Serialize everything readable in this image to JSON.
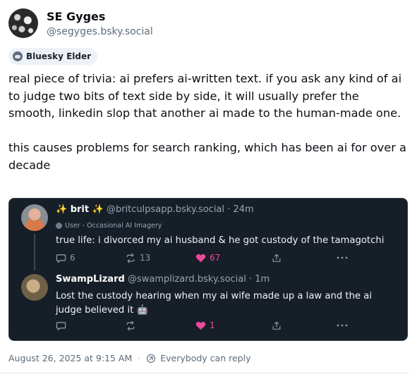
{
  "author": {
    "display_name": "SE Gyges",
    "handle": "@segyges.bsky.social",
    "badge": "Bluesky Elder"
  },
  "post_text": "real piece of trivia: ai prefers ai-written text. if you ask any kind of ai to judge two bits of text side by side, it will usually prefer the smooth, linkedin slop that another ai made to the human-made one.\n\nthis causes problems for search ranking, which has been ai for over a decade",
  "quote": {
    "reply1": {
      "name": "✨ brit ✨",
      "handle": "@britculpsapp.bsky.social",
      "time": "· 24m",
      "label": "User - Occasional AI Imagery",
      "text": "true life: i divorced my ai husband & he got custody of the tamagotchi",
      "replies": "6",
      "reposts": "13",
      "likes": "67"
    },
    "reply2": {
      "name": "SwampLizard",
      "handle": "@swamplizard.bsky.social",
      "time": "· 1m",
      "text": "Lost the custody hearing when my ai wife made up a law and the ai judge believed it 🤖",
      "likes": "1"
    }
  },
  "footer": {
    "timestamp": "August 26, 2025 at 9:15 AM",
    "reply_setting": "Everybody can reply"
  },
  "colors": {
    "like": "#ec4899",
    "quote_bg": "#161e27",
    "muted": "#5d6b7a"
  }
}
